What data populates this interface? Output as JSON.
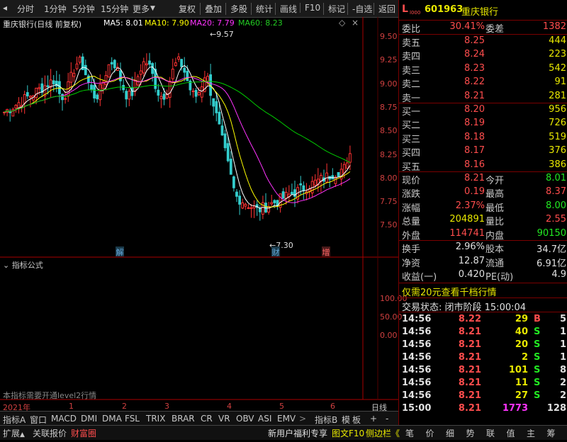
{
  "toolbar": {
    "left": [
      "分时",
      "1分钟",
      "5分钟",
      "15分钟",
      "更多"
    ],
    "right": [
      "复权",
      "叠加",
      "多股",
      "统计",
      "画线",
      "F10",
      "标记",
      "-自选",
      "返回"
    ]
  },
  "chart": {
    "title": "重庆银行(日线 前复权)",
    "ma": [
      {
        "label": "MA5: 8.01",
        "color": "#ffffff"
      },
      {
        "label": "MA10: 7.90",
        "color": "#ffff00"
      },
      {
        "label": "MA20: 7.79",
        "color": "#ff33ff"
      },
      {
        "label": "MA60: 8.23",
        "color": "#00cc00"
      }
    ],
    "yticks": [
      "9.50",
      "9.25",
      "9.00",
      "8.75",
      "8.50",
      "8.25",
      "8.00",
      "7.75",
      "7.50"
    ],
    "high_label": "9.57",
    "low_label": "7.30",
    "markers": [
      "解",
      "财",
      "增"
    ],
    "indicator_title": "指标公式",
    "indicator_ticks": [
      "100.00",
      "50.00",
      "0.00"
    ],
    "indicator_note": "本指标需要开通level2行情",
    "dates": [
      "2021年",
      "1",
      "2",
      "3",
      "4",
      "5",
      "6"
    ],
    "day_label": "日线"
  },
  "tabs": [
    "指标A",
    "窗口",
    "MACD",
    "DMI",
    "DMA",
    "FSL",
    "TRIX",
    "BRAR",
    "CR",
    "VR",
    "OBV",
    "ASI",
    "EMV"
  ],
  "tabs_right": [
    "指标B",
    "模",
    "板",
    "+",
    "-"
  ],
  "bottom": {
    "left": [
      "扩展",
      "关联报价",
      "财富圈"
    ],
    "promo": "新用户福利专享",
    "right": [
      "图文F10",
      "侧边栏《"
    ],
    "side_tabs": [
      "笔",
      "价",
      "细",
      "势",
      "联",
      "值",
      "主",
      "筹"
    ]
  },
  "quote": {
    "code": "601963",
    "name": "重庆银行",
    "weibi_label": "委比",
    "weibi": "30.41%",
    "weicha_label": "委差",
    "weicha": "1382",
    "asks": [
      {
        "label": "卖五",
        "price": "8.25",
        "vol": "444"
      },
      {
        "label": "卖四",
        "price": "8.24",
        "vol": "223"
      },
      {
        "label": "卖三",
        "price": "8.23",
        "vol": "542"
      },
      {
        "label": "卖二",
        "price": "8.22",
        "vol": "91"
      },
      {
        "label": "卖一",
        "price": "8.21",
        "vol": "281"
      }
    ],
    "bids": [
      {
        "label": "买一",
        "price": "8.20",
        "vol": "956"
      },
      {
        "label": "买二",
        "price": "8.19",
        "vol": "726"
      },
      {
        "label": "买三",
        "price": "8.18",
        "vol": "519"
      },
      {
        "label": "买四",
        "price": "8.17",
        "vol": "376"
      },
      {
        "label": "买五",
        "price": "8.16",
        "vol": "386"
      }
    ],
    "stats": [
      {
        "l1": "现价",
        "v1": "8.21",
        "c1": "red",
        "l2": "今开",
        "v2": "8.01",
        "c2": "green"
      },
      {
        "l1": "涨跌",
        "v1": "0.19",
        "c1": "red",
        "l2": "最高",
        "v2": "8.37",
        "c2": "red"
      },
      {
        "l1": "涨幅",
        "v1": "2.37%",
        "c1": "red",
        "l2": "最低",
        "v2": "8.00",
        "c2": "green"
      },
      {
        "l1": "总量",
        "v1": "204891",
        "c1": "yellow",
        "l2": "量比",
        "v2": "2.55",
        "c2": "red"
      },
      {
        "l1": "外盘",
        "v1": "114741",
        "c1": "red",
        "l2": "内盘",
        "v2": "90150",
        "c2": "green"
      }
    ],
    "stats2": [
      {
        "l1": "换手",
        "v1": "2.96%",
        "l2": "股本",
        "v2": "34.7亿"
      },
      {
        "l1": "净资",
        "v1": "12.87",
        "l2": "流通",
        "v2": "6.91亿"
      },
      {
        "l1": "收益(一)",
        "v1": "0.420",
        "l2": "PE(动)",
        "v2": "4.9"
      }
    ],
    "level2_promo": "仅需20元查看千档行情",
    "trade_status": "交易状态: 闭市阶段 15:00:04",
    "ticks": [
      {
        "t": "14:56",
        "p": "8.22",
        "v": "29",
        "s": "B",
        "n": "5",
        "pc": "red",
        "sc": "red"
      },
      {
        "t": "14:56",
        "p": "8.21",
        "v": "40",
        "s": "S",
        "n": "1",
        "pc": "red",
        "sc": "green"
      },
      {
        "t": "14:56",
        "p": "8.21",
        "v": "20",
        "s": "S",
        "n": "1",
        "pc": "red",
        "sc": "green"
      },
      {
        "t": "14:56",
        "p": "8.21",
        "v": "2",
        "s": "S",
        "n": "1",
        "pc": "red",
        "sc": "green"
      },
      {
        "t": "14:56",
        "p": "8.21",
        "v": "101",
        "s": "S",
        "n": "8",
        "pc": "red",
        "sc": "green"
      },
      {
        "t": "14:56",
        "p": "8.21",
        "v": "11",
        "s": "S",
        "n": "2",
        "pc": "red",
        "sc": "green"
      },
      {
        "t": "14:56",
        "p": "8.21",
        "v": "27",
        "s": "S",
        "n": "2",
        "pc": "red",
        "sc": "green"
      },
      {
        "t": "15:00",
        "p": "8.21",
        "v": "1773",
        "s": "",
        "n": "128",
        "pc": "red",
        "sc": "green"
      }
    ]
  }
}
